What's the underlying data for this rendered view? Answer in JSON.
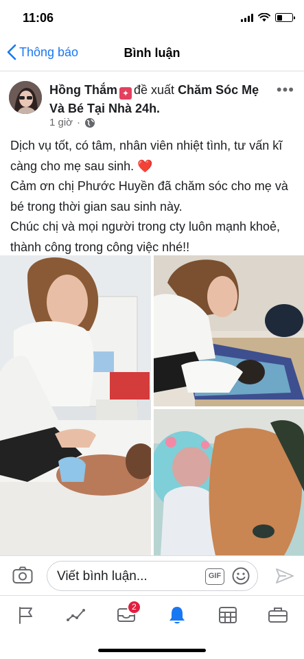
{
  "status_bar": {
    "time": "11:06"
  },
  "nav": {
    "back_label": "Thông báo",
    "title": "Bình luận"
  },
  "post": {
    "author": "Hồng Thắm",
    "action_text": "đề xuất",
    "page_name": "Chăm Sóc Mẹ Và Bé Tại Nhà 24h.",
    "time": "1 giờ",
    "separator": "·",
    "more_label": "•••",
    "text_lines": [
      "Dịch vụ tốt, có tâm, nhân viên nhiệt tình, tư vấn kĩ càng cho mẹ sau sinh.",
      "Cảm ơn chị Phước Huyền đã chăm sóc cho mẹ và bé trong thời gian sau sinh này.",
      "Chúc chị và mọi người trong cty luôn mạnh khoẻ, thành công trong công việc nhé!!"
    ],
    "heart_emoji": "❤️"
  },
  "comment_bar": {
    "placeholder": "Viết bình luận...",
    "gif_label": "GIF"
  },
  "tab_bar": {
    "tabs": [
      {
        "icon": "flag-icon",
        "active": false
      },
      {
        "icon": "activity-icon",
        "active": false
      },
      {
        "icon": "inbox-icon",
        "active": false,
        "badge": "2"
      },
      {
        "icon": "bell-icon",
        "active": true
      },
      {
        "icon": "calendar-grid-icon",
        "active": false
      },
      {
        "icon": "briefcase-icon",
        "active": false
      }
    ]
  },
  "colors": {
    "accent": "#1877f2",
    "badge": "#e41e3f",
    "text": "#1c1e21",
    "muted": "#65676b"
  }
}
